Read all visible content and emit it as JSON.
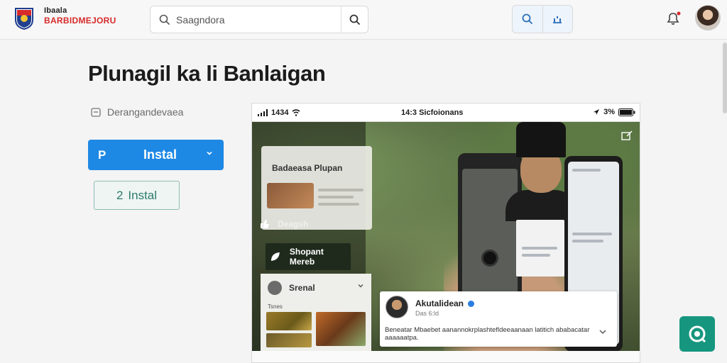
{
  "header": {
    "brand_top": "Ibaala",
    "brand_bottom": "BARBIDMEJORU",
    "search_placeholder": "Saagndora",
    "icons": [
      "search-icon",
      "chart-icon",
      "bell-icon"
    ]
  },
  "main": {
    "title": "Plunagil ka li Banlaigan",
    "subtitle": "Derangandevaea",
    "primary_button": {
      "icon": "P",
      "label": "Instal"
    },
    "secondary_button": {
      "icon": "2",
      "label": "Instal"
    }
  },
  "mockup": {
    "status_time": "1434",
    "status_center": "14:3 Sicfoionans",
    "status_battery": "3%",
    "list_title": "Badaeasa Plupan",
    "like_label": "Deagsh",
    "chip_label": "Shopant Mereb",
    "lower_name": "Srenal",
    "lower_sub": "Tsnes",
    "profile": {
      "name": "Akutalidean",
      "meta": "Das 6:ld",
      "description": "Beneatar Mbaebet aanannokrplashtefldeeaanaan latitich ababacatar aaaaaatpa."
    }
  },
  "colors": {
    "primary": "#1e88e5",
    "secondary_text": "#2d7a6c",
    "fab": "#17967f",
    "brand_red": "#d62a2a"
  }
}
